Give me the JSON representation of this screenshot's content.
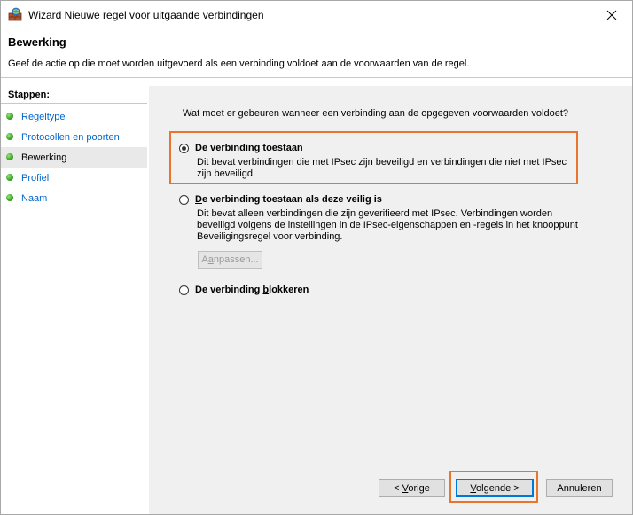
{
  "window": {
    "title": "Wizard Nieuwe regel voor uitgaande verbindingen"
  },
  "header": {
    "title": "Bewerking",
    "description": "Geef de actie op die moet worden uitgevoerd als een verbinding voldoet aan de voorwaarden van de regel."
  },
  "sidebar": {
    "heading": "Stappen:",
    "items": [
      {
        "label": "Regeltype",
        "current": false
      },
      {
        "label": "Protocollen en poorten",
        "current": false
      },
      {
        "label": "Bewerking",
        "current": true
      },
      {
        "label": "Profiel",
        "current": false
      },
      {
        "label": "Naam",
        "current": false
      }
    ]
  },
  "main": {
    "question": "Wat moet er gebeuren wanneer een verbinding aan de opgegeven voorwaarden voldoet?",
    "options": [
      {
        "label_pre": "D",
        "label_mnemonic": "e",
        "label_post": " verbinding toestaan",
        "description": "Dit bevat verbindingen die met IPsec zijn beveiligd en verbindingen die niet met IPsec zijn beveiligd.",
        "checked": true
      },
      {
        "label_pre": "",
        "label_mnemonic": "D",
        "label_post": "e verbinding toestaan als deze veilig is",
        "description": "Dit bevat alleen verbindingen die zijn geverifieerd met IPsec. Verbindingen worden beveiligd volgens de instellingen in de IPsec-eigenschappen en -regels in het knooppunt Beveiligingsregel voor verbinding.",
        "checked": false
      },
      {
        "label_pre": "De verbinding ",
        "label_mnemonic": "b",
        "label_post": "lokkeren",
        "description": "",
        "checked": false
      }
    ],
    "customize_button": {
      "pre": "A",
      "mnemonic": "a",
      "post": "npassen..."
    }
  },
  "footer": {
    "prev_button": {
      "pre": "< ",
      "mnemonic": "V",
      "post": "orige"
    },
    "next_button": {
      "pre": "",
      "mnemonic": "V",
      "post": "olgende >"
    },
    "cancel_button": {
      "label": "Annuleren"
    }
  },
  "colors": {
    "highlight": "#e9742c",
    "link": "#0066cc",
    "content_bg": "#f0f0f0",
    "focus_border": "#0078d7"
  }
}
